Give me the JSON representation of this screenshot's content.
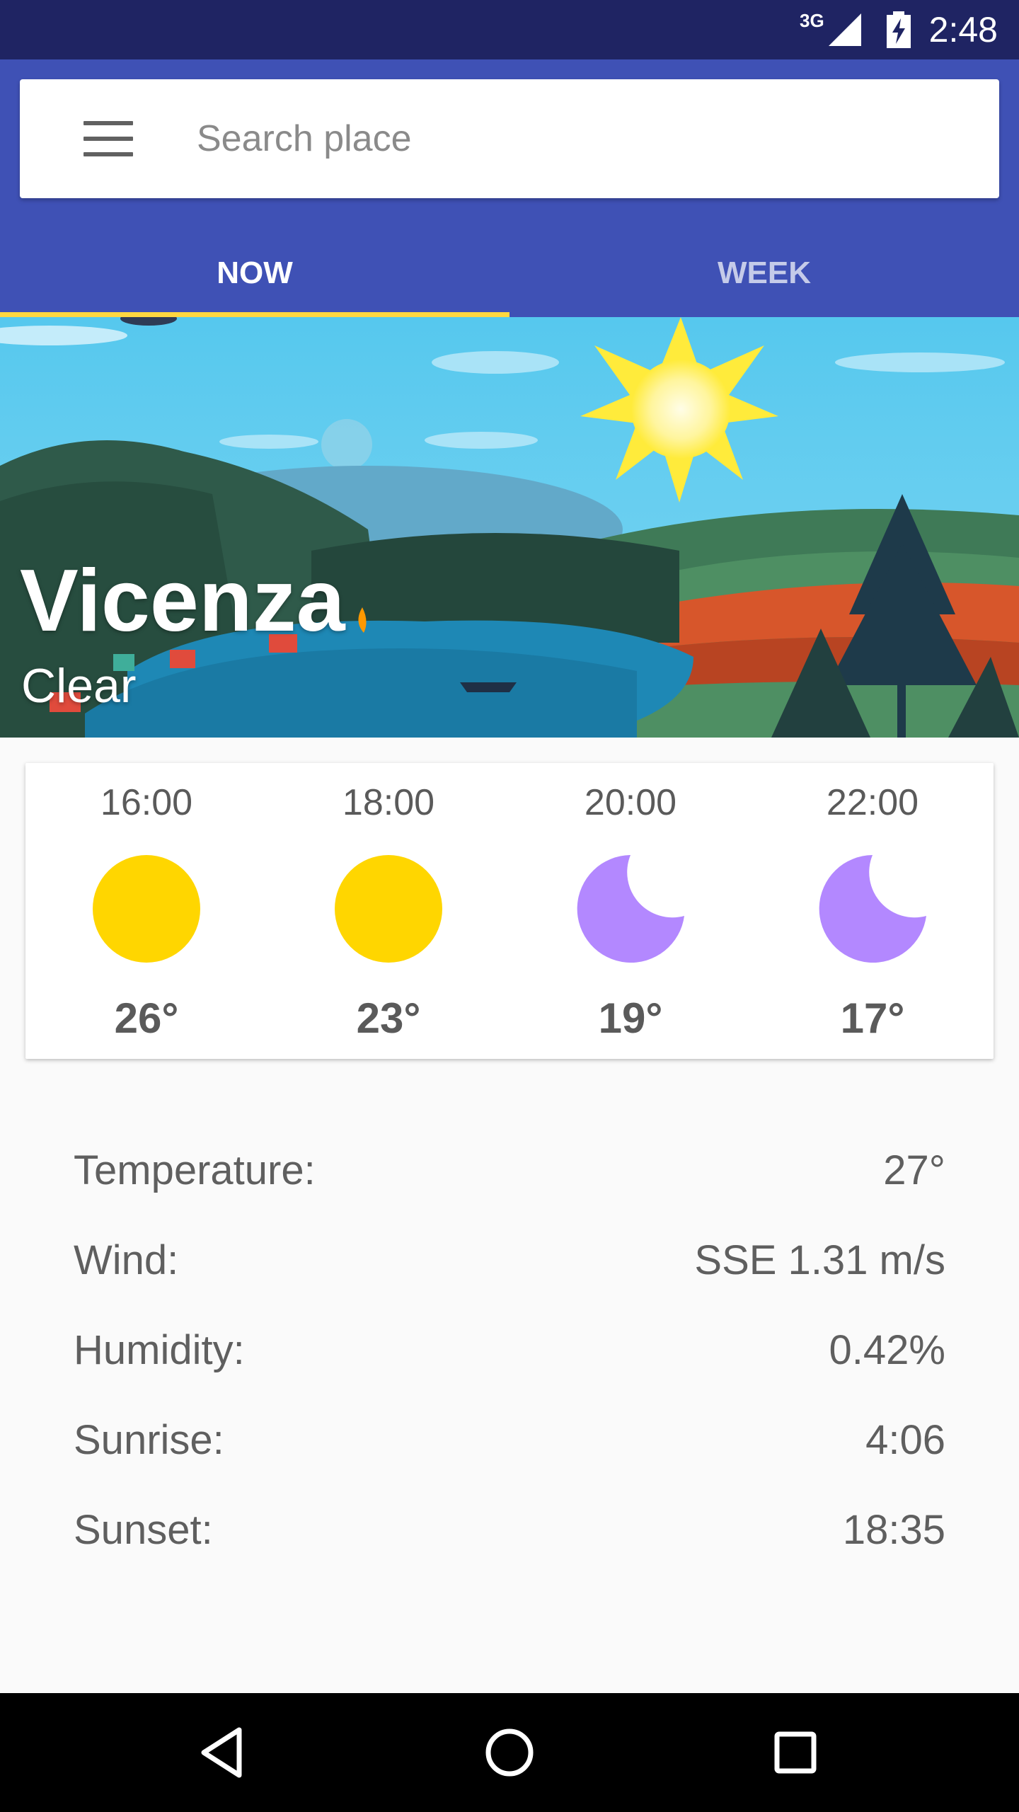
{
  "status_bar": {
    "network": "3G",
    "time": "2:48"
  },
  "search": {
    "placeholder": "Search place",
    "menu_icon": "menu-icon"
  },
  "tabs": [
    {
      "label": "NOW",
      "active": true
    },
    {
      "label": "WEEK",
      "active": false
    }
  ],
  "location": {
    "city": "Vicenza",
    "condition": "Clear"
  },
  "forecast": [
    {
      "time": "16:00",
      "icon": "sun-icon",
      "temp": "26°"
    },
    {
      "time": "18:00",
      "icon": "sun-icon",
      "temp": "23°"
    },
    {
      "time": "20:00",
      "icon": "moon-icon",
      "temp": "19°"
    },
    {
      "time": "22:00",
      "icon": "moon-icon",
      "temp": "17°"
    }
  ],
  "details": [
    {
      "label": "Temperature:",
      "value": "27°"
    },
    {
      "label": "Wind:",
      "value": "SSE 1.31 m/s"
    },
    {
      "label": "Humidity:",
      "value": "0.42%"
    },
    {
      "label": "Sunrise:",
      "value": "4:06"
    },
    {
      "label": "Sunset:",
      "value": "18:35"
    }
  ],
  "colors": {
    "primary": "#3F51B5",
    "primary_dark": "#1F2463",
    "accent": "#FFD740",
    "sun": "#FFD600",
    "moon": "#B388FF"
  },
  "nav": {
    "back": "back-icon",
    "home": "home-icon",
    "recents": "recents-icon"
  }
}
